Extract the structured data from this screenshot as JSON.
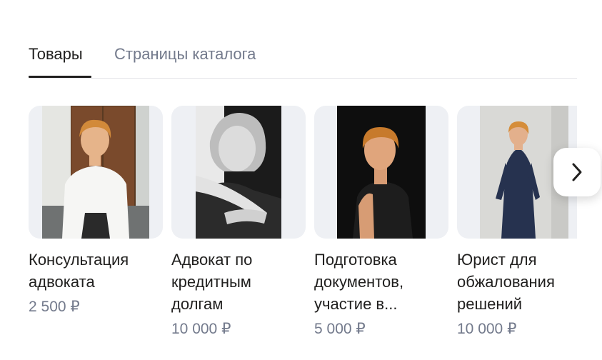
{
  "tabs": [
    {
      "label": "Товары",
      "active": true
    },
    {
      "label": "Страницы каталога",
      "active": false
    }
  ],
  "products": [
    {
      "title": "Консультация адвоката",
      "price": "2 500 ₽",
      "image_icon": "lawyer-portrait-white-blouse"
    },
    {
      "title": "Адвокат по кредитным долгам",
      "price": "10 000 ₽",
      "image_icon": "lawyer-portrait-bw"
    },
    {
      "title": "Подготовка документов, участие в...",
      "price": "5 000 ₽",
      "image_icon": "lawyer-portrait-dark"
    },
    {
      "title": "Юрист для обжалования решений",
      "price": "10 000 ₽",
      "image_icon": "lawyer-portrait-navy-suit"
    }
  ],
  "next_button_icon": "chevron-right-icon",
  "colors": {
    "text": "#21201f",
    "secondary": "#737a8c",
    "card_bg": "#eef0f4",
    "divider": "#e3e4e8"
  }
}
